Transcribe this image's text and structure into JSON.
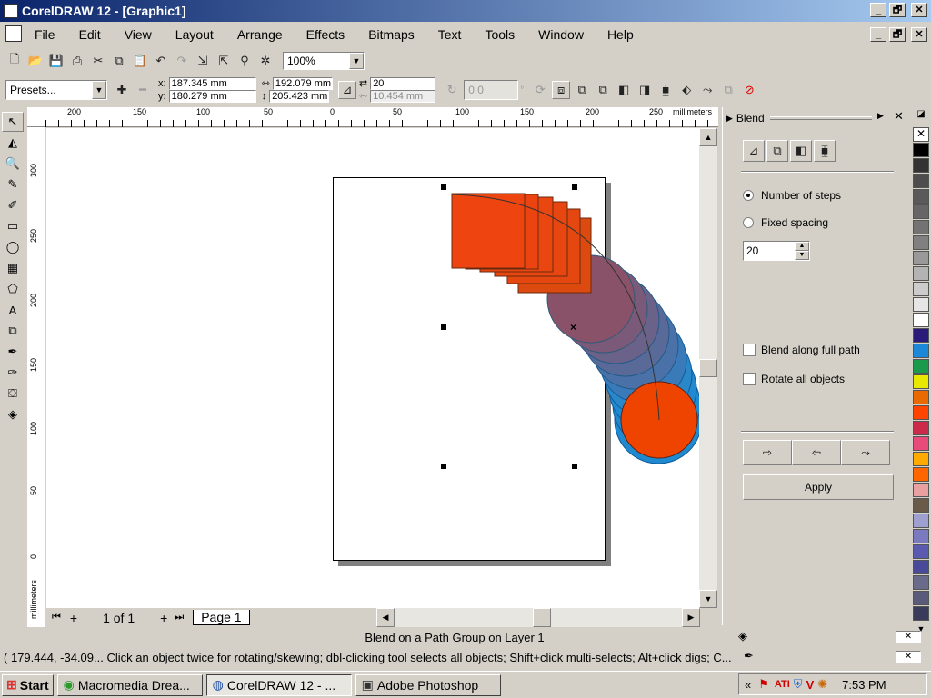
{
  "window": {
    "title": "CorelDRAW 12 - [Graphic1]",
    "minimize": "_",
    "restore": "🗗",
    "close": "✕"
  },
  "menu": [
    "File",
    "Edit",
    "View",
    "Layout",
    "Arrange",
    "Effects",
    "Bitmaps",
    "Text",
    "Tools",
    "Window",
    "Help"
  ],
  "toolbar": {
    "zoom": "100%"
  },
  "propbar": {
    "presets": "Presets...",
    "x": "187.345 mm",
    "y": "180.279 mm",
    "width": "192.079 mm",
    "height": "205.423 mm",
    "steps": "20",
    "spacing": "10.454 mm",
    "angle": "0.0",
    "angle_unit": "°"
  },
  "ruler": {
    "h_ticks": [
      "200",
      "150",
      "100",
      "50",
      "0",
      "50",
      "100",
      "150",
      "200",
      "250"
    ],
    "unit": "millimeters",
    "v_ticks": [
      "300",
      "250",
      "200",
      "150",
      "100",
      "50",
      "0"
    ]
  },
  "page_nav": {
    "count": "1 of 1",
    "page_tab": "Page 1"
  },
  "docker": {
    "title": "Blend",
    "opt_steps": "Number of steps",
    "opt_spacing": "Fixed spacing",
    "steps_value": "20",
    "blend_full_path": "Blend along full path",
    "rotate_all": "Rotate all objects",
    "apply": "Apply"
  },
  "status": {
    "line1": "Blend on a Path Group on Layer 1",
    "line2": "( 179.444, -34.09... Click an object twice for rotating/skewing; dbl-clicking tool selects all objects; Shift+click multi-selects; Alt+click digs; C..."
  },
  "taskbar": {
    "start": "Start",
    "tasks": [
      "Macromedia Drea...",
      "CorelDRAW 12 - ...",
      "Adobe Photoshop"
    ],
    "clock": "7:53 PM",
    "tray_expand": "«"
  },
  "palette_colors": [
    "#000000",
    "#333333",
    "#4d4d4d",
    "#5a5a5a",
    "#666666",
    "#737373",
    "#808080",
    "#999999",
    "#b3b3b3",
    "#cccccc",
    "#e6e6e6",
    "#ffffff",
    "#2a1a7a",
    "#1e88d8",
    "#1a9a4a",
    "#e8e800",
    "#e86a00",
    "#ff4400",
    "#cc2a4a",
    "#e84a7a",
    "#ffaa00",
    "#ff6600",
    "#e8a0a0",
    "#6a5a4a",
    "#a0a0d0",
    "#7a7ac0",
    "#5a5ab0",
    "#4a4a9a",
    "#6a6a8a",
    "#5a5a7a",
    "#3a3a5a"
  ]
}
